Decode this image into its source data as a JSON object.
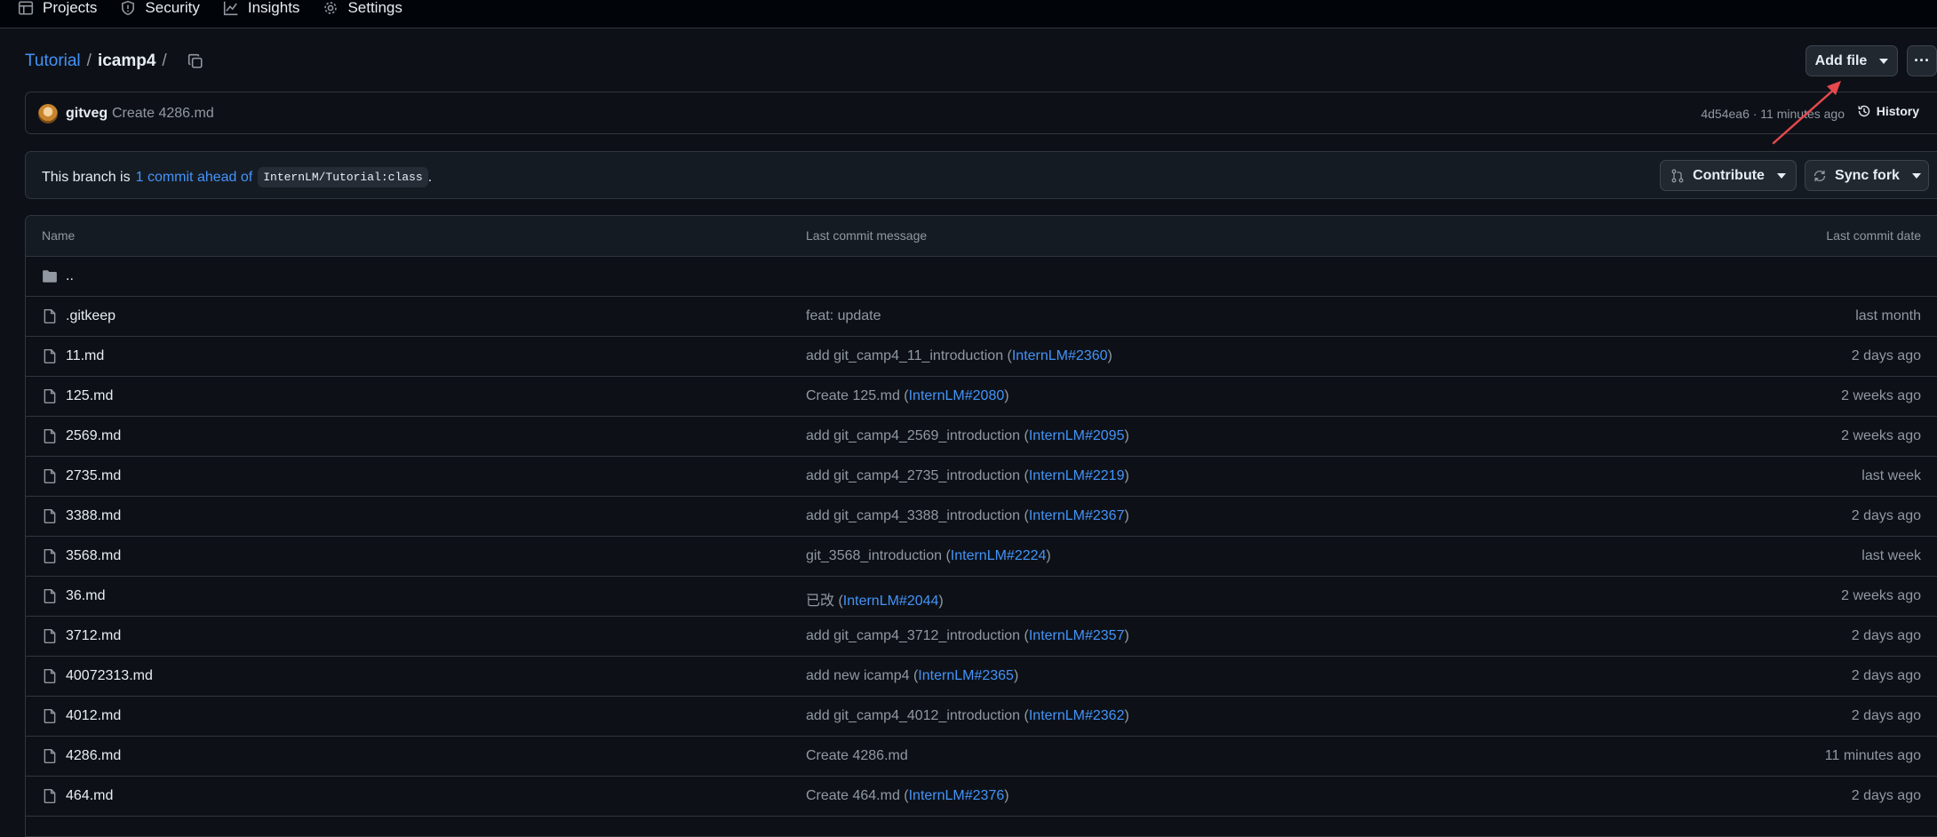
{
  "nav": {
    "items": [
      {
        "label": "Projects",
        "icon": "table-icon"
      },
      {
        "label": "Security",
        "icon": "shield-icon"
      },
      {
        "label": "Insights",
        "icon": "graph-icon"
      },
      {
        "label": "Settings",
        "icon": "gear-icon"
      }
    ]
  },
  "breadcrumb": {
    "repo": "Tutorial",
    "sep1": "/",
    "folder": "icamp4",
    "sep2": "/"
  },
  "actions": {
    "add_file": "Add file",
    "more": "···"
  },
  "latest_commit": {
    "author": "gitveg",
    "message": "Create 4286.md",
    "meta": "4d54ea6 · 11 minutes ago",
    "history": "History"
  },
  "branch": {
    "prefix": "This branch is",
    "ahead_link": "1 commit ahead of",
    "base_ref": "InternLM/Tutorial:class",
    "suffix": ".",
    "contribute": "Contribute",
    "sync_fork": "Sync fork"
  },
  "table": {
    "headers": {
      "name": "Name",
      "message": "Last commit message",
      "date": "Last commit date"
    },
    "parent": "..",
    "rows": [
      {
        "name": ".gitkeep",
        "msg": "feat: update",
        "pr": "",
        "close": "",
        "date": "last month"
      },
      {
        "name": "11.md",
        "msg": "add git_camp4_11_introduction (",
        "pr": "InternLM#2360",
        "close": ")",
        "date": "2 days ago"
      },
      {
        "name": "125.md",
        "msg": "Create 125.md (",
        "pr": "InternLM#2080",
        "close": ")",
        "date": "2 weeks ago"
      },
      {
        "name": "2569.md",
        "msg": "add git_camp4_2569_introduction (",
        "pr": "InternLM#2095",
        "close": ")",
        "date": "2 weeks ago"
      },
      {
        "name": "2735.md",
        "msg": "add git_camp4_2735_introduction (",
        "pr": "InternLM#2219",
        "close": ")",
        "date": "last week"
      },
      {
        "name": "3388.md",
        "msg": "add git_camp4_3388_introduction (",
        "pr": "InternLM#2367",
        "close": ")",
        "date": "2 days ago"
      },
      {
        "name": "3568.md",
        "msg": "git_3568_introduction (",
        "pr": "InternLM#2224",
        "close": ")",
        "date": "last week"
      },
      {
        "name": "36.md",
        "msg": "已改 (",
        "pr": "InternLM#2044",
        "close": ")",
        "date": "2 weeks ago"
      },
      {
        "name": "3712.md",
        "msg": "add git_camp4_3712_introduction (",
        "pr": "InternLM#2357",
        "close": ")",
        "date": "2 days ago"
      },
      {
        "name": "40072313.md",
        "msg": "add new icamp4 (",
        "pr": "InternLM#2365",
        "close": ")",
        "date": "2 days ago"
      },
      {
        "name": "4012.md",
        "msg": "add git_camp4_4012_introduction (",
        "pr": "InternLM#2362",
        "close": ")",
        "date": "2 days ago"
      },
      {
        "name": "4286.md",
        "msg": "Create 4286.md",
        "pr": "",
        "close": "",
        "date": "11 minutes ago"
      },
      {
        "name": "464.md",
        "msg": "Create 464.md (",
        "pr": "InternLM#2376",
        "close": ")",
        "date": "2 days ago"
      }
    ]
  },
  "colors": {
    "background": "#0d1117",
    "link": "#4493f8",
    "annotation_arrow": "#e5484d"
  }
}
